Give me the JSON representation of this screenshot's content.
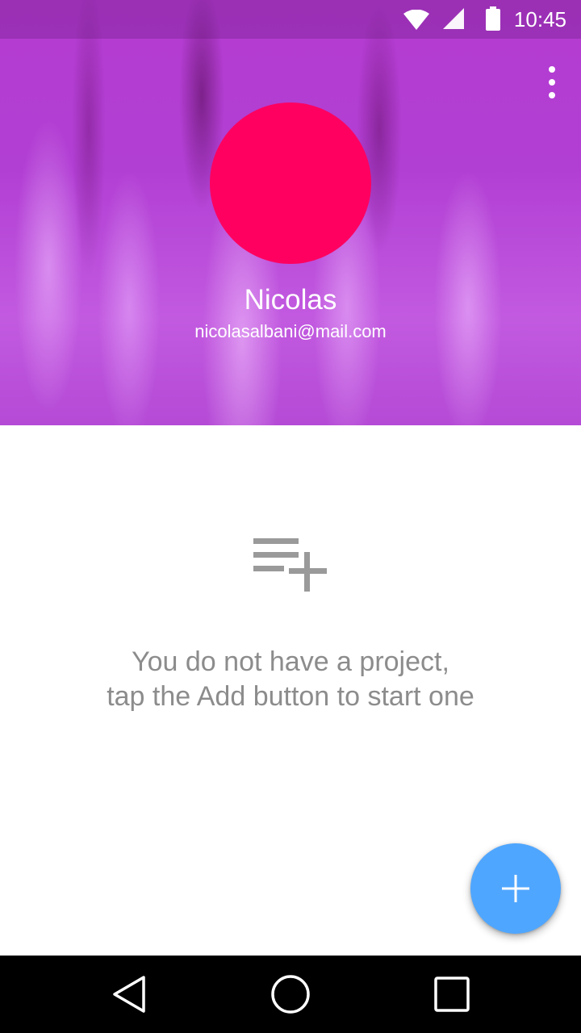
{
  "status_bar": {
    "time": "10:45",
    "icons": [
      "wifi-icon",
      "signal-icon",
      "battery-icon"
    ]
  },
  "header": {
    "overflow_menu_icon": "more-vert-icon",
    "avatar_color": "#ff0060",
    "name": "Nicolas",
    "email": "nicolasalbani@mail.com"
  },
  "empty_state": {
    "icon": "playlist-add-icon",
    "line1": "You do not have a project,",
    "line2": "tap the Add button to start one"
  },
  "fab": {
    "icon": "plus-icon",
    "color": "#4fa6ff"
  },
  "nav_bar": {
    "buttons": [
      "back-icon",
      "home-icon",
      "recents-icon"
    ]
  }
}
